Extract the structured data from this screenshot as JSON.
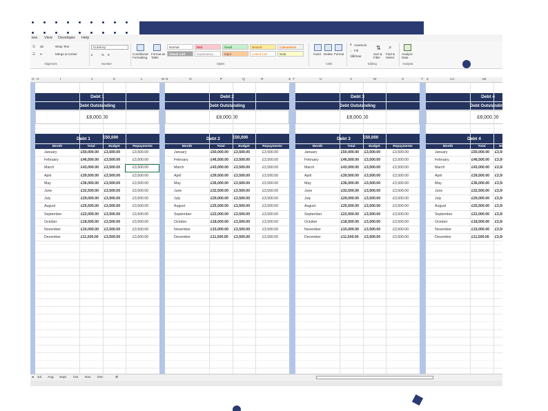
{
  "menu": [
    "iew",
    "View",
    "Developer",
    "Help"
  ],
  "ribbon": {
    "wrap_text": "Wrap Text",
    "merge_center": "Merge & Center",
    "number_format": "Currency",
    "currency_symbol": "£",
    "percent": "%",
    "comma": "9",
    "conditional_formatting": "Conditional Formatting",
    "format_as_table": "Format as Table",
    "styles": [
      "Normal",
      "Bad",
      "Good",
      "Neutral",
      "Calculation",
      "Check Cell",
      "Explanatory...",
      "Input",
      "Linked Cell",
      "Note"
    ],
    "insert": "Insert",
    "delete": "Delete",
    "format": "Format",
    "autosum": "AutoSum",
    "fill": "Fill",
    "clear": "Clear",
    "sort_filter": "Sort & Filter",
    "find_select": "Find & Select",
    "analyze_data": "Analyze Data",
    "groups": [
      "Alignment",
      "Number",
      "Styles",
      "Cells",
      "Editing",
      "Analysis"
    ]
  },
  "columns": [
    "G",
    "H",
    "I",
    "J",
    "K",
    "L",
    "M",
    "N",
    "O",
    "P",
    "Q",
    "R",
    "S",
    "T",
    "U",
    "V",
    "W",
    "X",
    "Y",
    "Z",
    "AA",
    "AB"
  ],
  "panels": [
    {
      "title": "Debt 1",
      "outstanding_label": "Debt Outstanding",
      "outstanding": "£8,000.00",
      "table_title": "Debt 1",
      "overview": "£50,000"
    },
    {
      "title": "Debt 2",
      "outstanding_label": "Debt Outstanding",
      "outstanding": "£8,000.00",
      "table_title": "Debt 2",
      "overview": "£50,000"
    },
    {
      "title": "Debt 3",
      "outstanding_label": "Debt Outstanding",
      "outstanding": "£8,000.00",
      "table_title": "Debt 3",
      "overview": "£50,000"
    },
    {
      "title": "Debt 4",
      "outstanding_label": "Debt Outstanding",
      "outstanding": "£8,000.00",
      "table_title": "Debt 4",
      "overview": ""
    }
  ],
  "table_headers": [
    "Month",
    "Total",
    "Budget",
    "Repayments"
  ],
  "rows": [
    [
      "January",
      "£50,000.00",
      "£3,500.00",
      "£3,500.00"
    ],
    [
      "February",
      "£46,500.00",
      "£3,500.00",
      "£3,500.00"
    ],
    [
      "March",
      "£43,000.00",
      "£3,500.00",
      "£3,500.00"
    ],
    [
      "April",
      "£39,500.00",
      "£3,500.00",
      "£3,500.00"
    ],
    [
      "May",
      "£36,000.00",
      "£3,500.00",
      "£3,500.00"
    ],
    [
      "June",
      "£32,500.00",
      "£3,500.00",
      "£3,500.00"
    ],
    [
      "July",
      "£29,000.00",
      "£3,500.00",
      "£3,500.00"
    ],
    [
      "August",
      "£25,500.00",
      "£3,500.00",
      "£3,500.00"
    ],
    [
      "September",
      "£22,000.00",
      "£3,500.00",
      "£3,500.00"
    ],
    [
      "October",
      "£18,500.00",
      "£3,500.00",
      "£3,500.00"
    ],
    [
      "November",
      "£15,000.00",
      "£3,500.00",
      "£3,500.00"
    ],
    [
      "December",
      "£11,500.00",
      "£3,500.00",
      "£3,500.00"
    ]
  ],
  "sheet_tabs": [
    "Jul",
    "Aug",
    "Sept",
    "Oct",
    "Nov",
    "Dec"
  ],
  "colors": {
    "navy": "#24345f",
    "panel_bg": "#b4c6e7",
    "accent": "#2b3a73"
  }
}
